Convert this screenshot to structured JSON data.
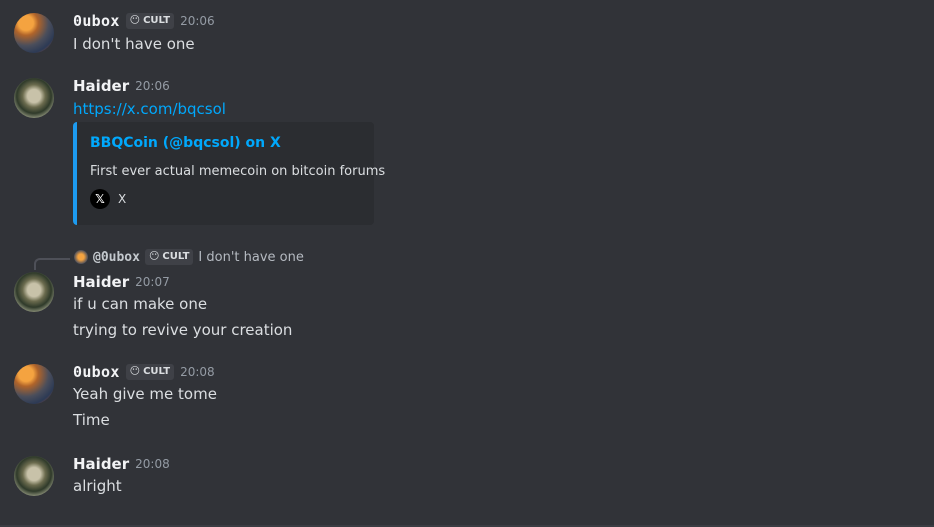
{
  "messages": [
    {
      "author": "0ubox",
      "tag": "CULT",
      "time": "20:06",
      "lines": [
        "I don't have one"
      ]
    },
    {
      "author": "Haider",
      "time": "20:06",
      "link": "https://x.com/bqcsol",
      "embed": {
        "title": "BBQCoin (@bqcsol) on X",
        "description": "First ever actual memecoin on bitcoin forums",
        "provider": "X",
        "provider_icon": "x-logo-icon",
        "accent": "#1d9bf0"
      }
    },
    {
      "author": "Haider",
      "time": "20:07",
      "reply": {
        "author": "@0ubox",
        "tag": "CULT",
        "text": "I don't have one"
      },
      "lines": [
        "if u can make one",
        "trying to revive your creation"
      ]
    },
    {
      "author": "0ubox",
      "tag": "CULT",
      "time": "20:08",
      "lines": [
        "Yeah give me tome",
        "Time"
      ]
    },
    {
      "author": "Haider",
      "time": "20:08",
      "lines": [
        "alright"
      ]
    }
  ],
  "tag_icon": "😶",
  "x_glyph": "𝕏",
  "colors": {
    "background": "#313338",
    "link": "#00a8fc",
    "embed_bg": "#2b2d31"
  }
}
